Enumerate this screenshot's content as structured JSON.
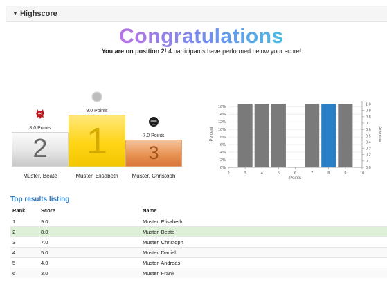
{
  "panel": {
    "title": "Highscore"
  },
  "headline": {
    "title": "Congratulations",
    "position_bold": "You are on position 2!",
    "position_rest": " 4 participants have performed below your score!"
  },
  "podium": {
    "second": {
      "rank": "2",
      "points": "8.0 Points",
      "name": "Muster, Beate"
    },
    "first": {
      "rank": "1",
      "points": "9.0 Points",
      "name": "Muster, Elisabeth"
    },
    "third": {
      "rank": "3",
      "points": "7.0 Points",
      "name": "Muster, Christoph"
    }
  },
  "colors": {
    "bar": "#7a7a7a",
    "bar_highlight": "#2a80c6",
    "row_highlight": "#dff0d8",
    "link": "#2e79c2"
  },
  "listing": {
    "title": "Top results listing",
    "headers": {
      "rank": "Rank",
      "score": "Score",
      "name": "Name"
    },
    "rows": [
      {
        "rank": "1",
        "score": "9.0",
        "name": "Muster, Elisabeth"
      },
      {
        "rank": "2",
        "score": "8.0",
        "name": "Muster, Beate"
      },
      {
        "rank": "3",
        "score": "7.0",
        "name": "Muster, Christoph"
      },
      {
        "rank": "4",
        "score": "5.0",
        "name": "Muster, Daniel"
      },
      {
        "rank": "5",
        "score": "4.0",
        "name": "Muster, Andreas"
      },
      {
        "rank": "6",
        "score": "3.0",
        "name": "Muster, Frank"
      }
    ]
  },
  "chart_data": {
    "type": "bar",
    "x": [
      3,
      4,
      5,
      7,
      8,
      9
    ],
    "values": [
      16.7,
      16.7,
      16.7,
      16.7,
      16.7,
      16.7
    ],
    "highlight_x": 8,
    "xlim": [
      2,
      10
    ],
    "xticks": [
      "2",
      "3",
      "4",
      "5",
      "6",
      "7",
      "8",
      "9",
      "10"
    ],
    "xlabel": "Points",
    "ylabel": "Percent",
    "ylim": [
      0,
      17.5
    ],
    "yticks": [
      "0%",
      "2%",
      "4%",
      "6%",
      "8%",
      "10%",
      "12%",
      "14%",
      "16%"
    ],
    "y2label": "Absolute",
    "y2lim": [
      0,
      1.05
    ],
    "y2ticks": [
      "0.0",
      "0.1",
      "0.2",
      "0.3",
      "0.4",
      "0.5",
      "0.6",
      "0.7",
      "0.8",
      "0.9",
      "1.0"
    ],
    "grid": true
  }
}
